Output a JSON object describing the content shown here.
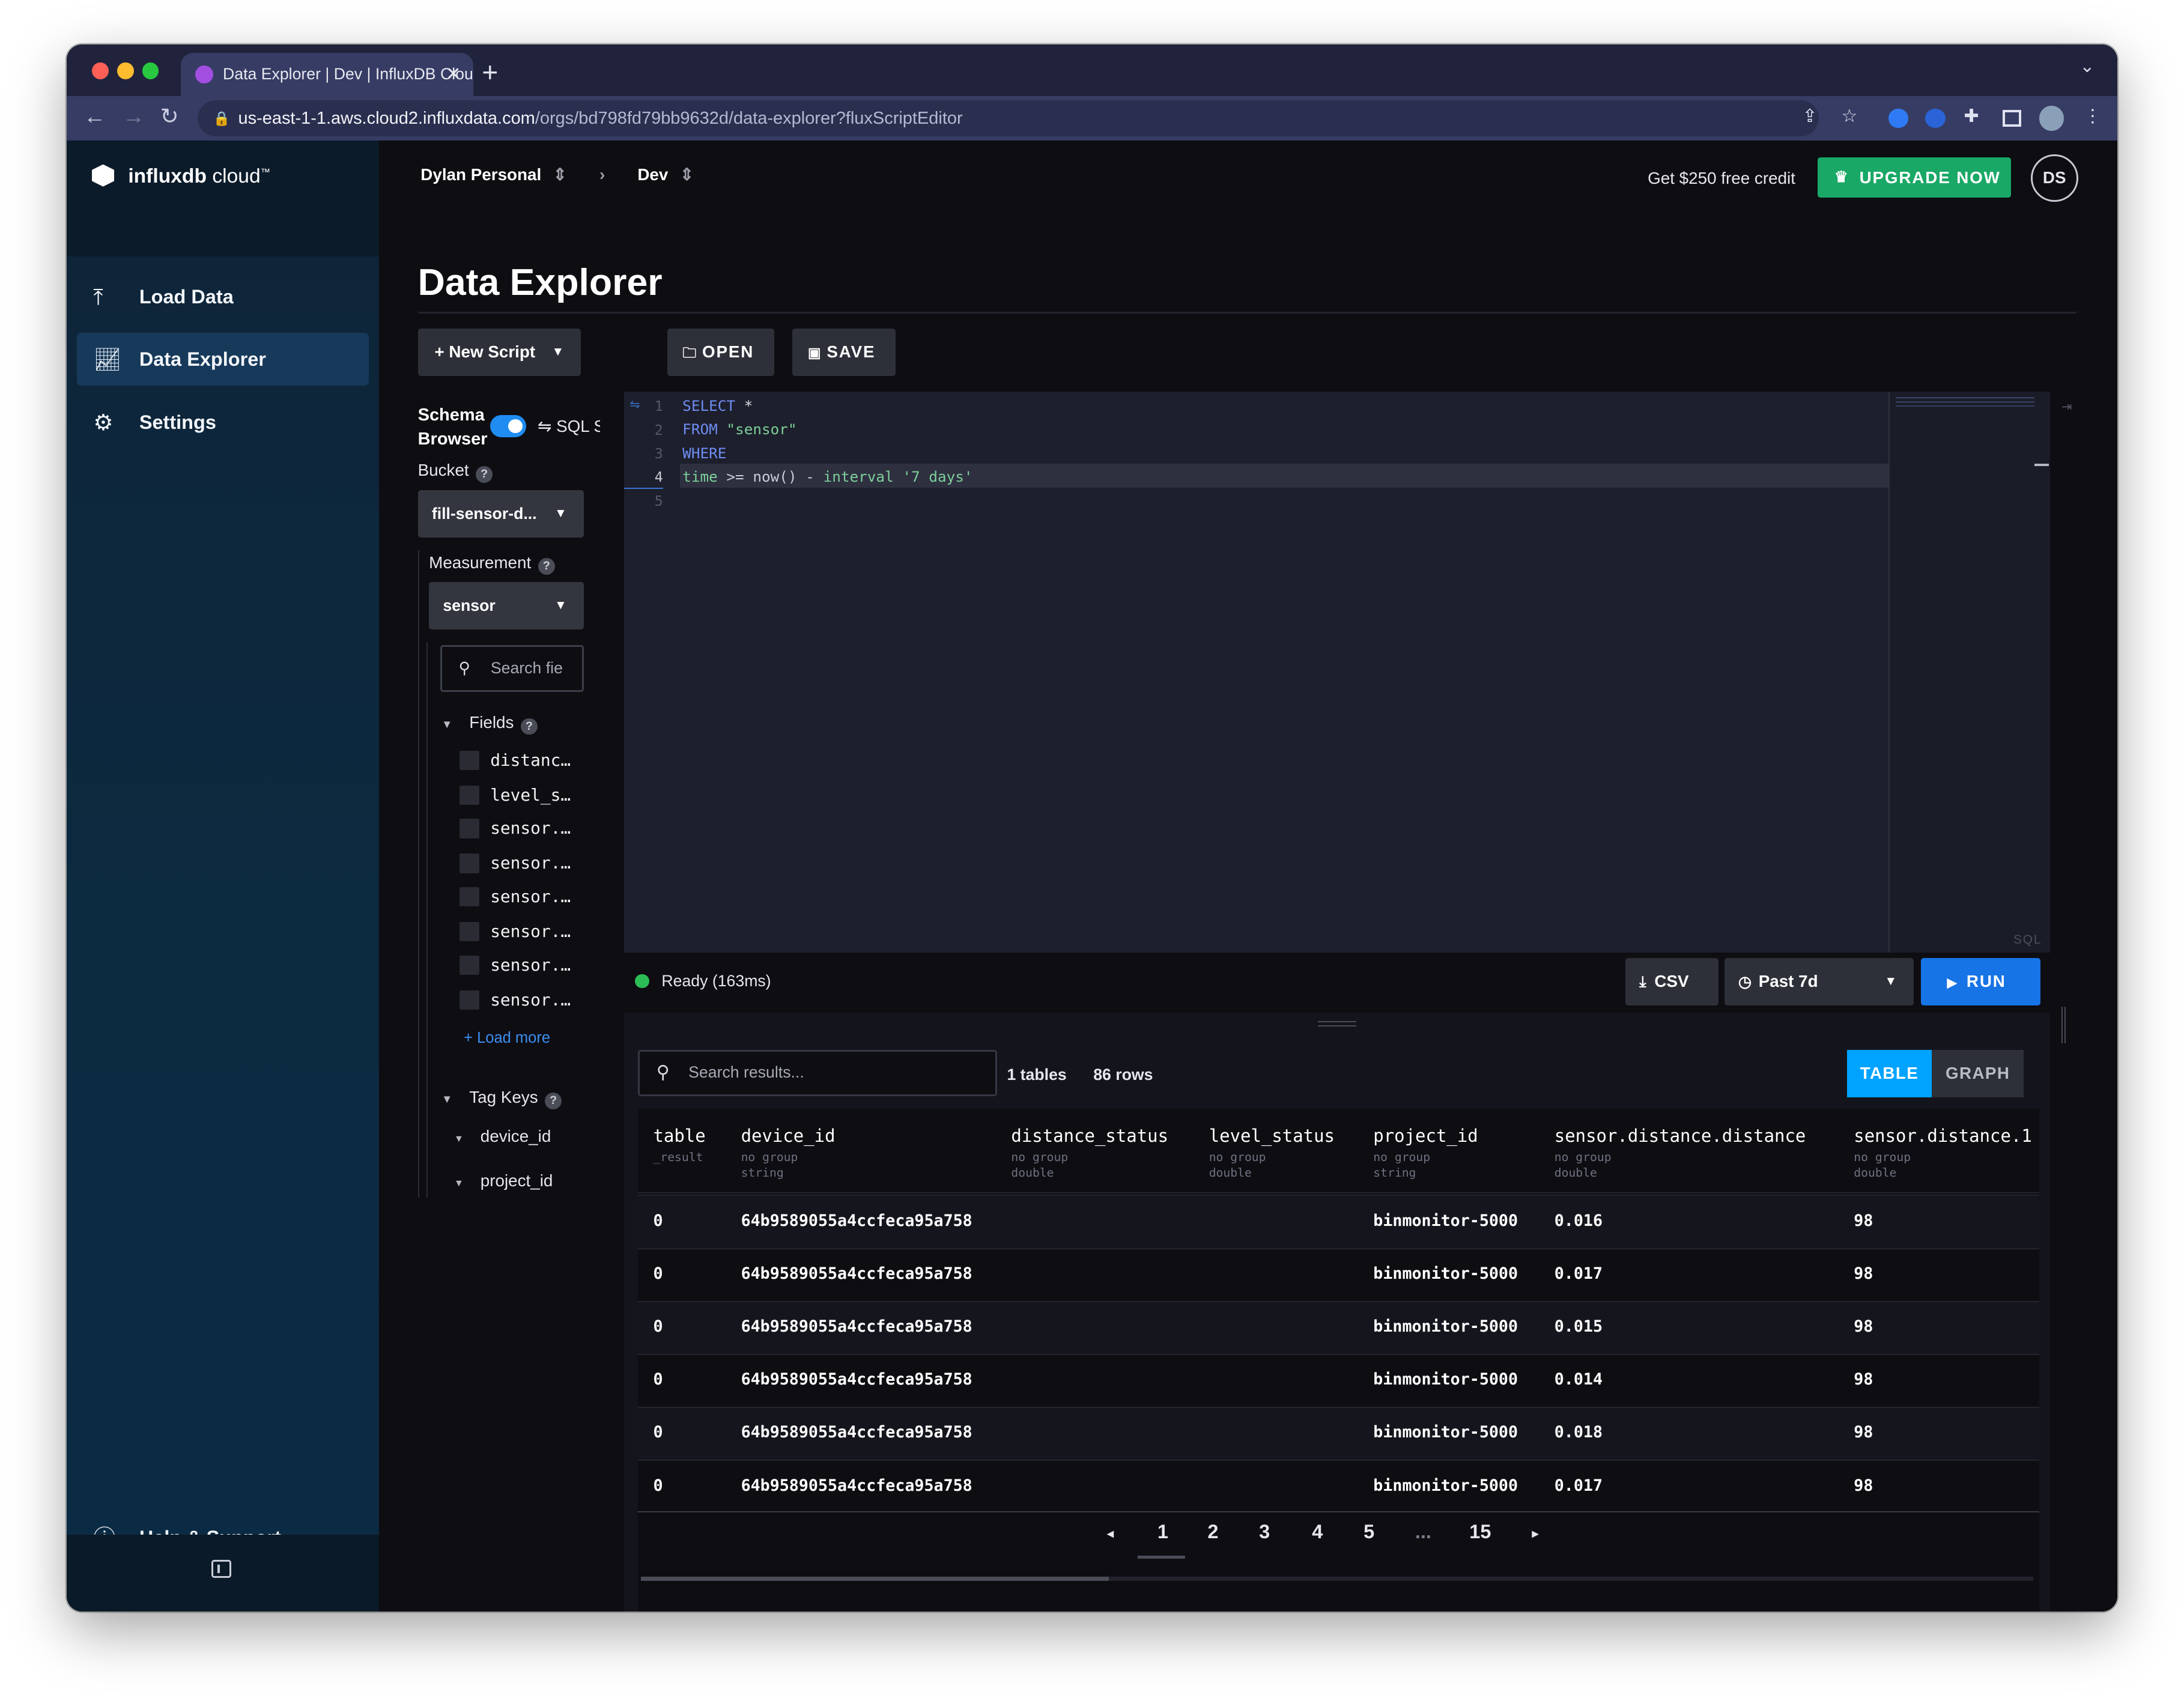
{
  "browser": {
    "tab_title": "Data Explorer | Dev | InfluxDB Cloud",
    "tab_close": "✕",
    "new_tab": "+",
    "url_host": "us-east-1-1.aws.cloud2.influxdata.com",
    "url_path": "/orgs/bd798fd79bb9632d/data-explorer?fluxScriptEditor"
  },
  "sidebar": {
    "logo_bold": "influxdb",
    "logo_light": " cloud",
    "logo_tm": "™",
    "items": [
      {
        "label": "Load Data",
        "icon": "upload-icon"
      },
      {
        "label": "Data Explorer",
        "icon": "chart-line-icon"
      },
      {
        "label": "Settings",
        "icon": "gear-icon"
      }
    ],
    "help": "Help & Support"
  },
  "header": {
    "org": "Dylan Personal",
    "bucket_env": "Dev",
    "credit": "Get $250 free credit",
    "upgrade": "UPGRADE NOW",
    "avatar": "DS"
  },
  "page_title": "Data Explorer",
  "toolbar": {
    "new_script": "New Script",
    "open": "OPEN",
    "save": "SAVE"
  },
  "schema": {
    "title_line1": "Schema",
    "title_line2": "Browser",
    "toggle_label": "SQL S",
    "bucket_label": "Bucket",
    "bucket_value": "fill-sensor-d...",
    "measurement_label": "Measurement",
    "measurement_value": "sensor",
    "search_placeholder": "Search fie",
    "fields_label": "Fields",
    "fields": [
      "distanc…",
      "level_s…",
      "sensor.…",
      "sensor.…",
      "sensor.…",
      "sensor.…",
      "sensor.…",
      "sensor.…"
    ],
    "load_more": "+ Load more",
    "tag_keys_label": "Tag Keys",
    "tag_keys": [
      "device_id",
      "project_id"
    ]
  },
  "editor": {
    "line_numbers": [
      "1",
      "2",
      "3",
      "4",
      "5"
    ],
    "lang": "SQL",
    "code": {
      "l1_kw": "SELECT",
      "l1_rest": " *",
      "l2_kw": "FROM",
      "l2_str": " \"sensor\"",
      "l3_kw": "WHERE",
      "l4_a": "time",
      "l4_b": " >= ",
      "l4_c": "now()",
      "l4_d": " - ",
      "l4_e": "interval",
      "l4_f": " '7 days'"
    }
  },
  "status": {
    "ready": "Ready (163ms)",
    "csv": "CSV",
    "time_range": "Past 7d",
    "run": "RUN"
  },
  "results": {
    "search_placeholder": "Search results...",
    "tables": "1 tables",
    "rows": "86 rows",
    "view_table": "TABLE",
    "view_graph": "GRAPH",
    "columns": [
      {
        "name": "table",
        "sub1": "_result",
        "sub2": ""
      },
      {
        "name": "device_id",
        "sub1": "no group",
        "sub2": "string"
      },
      {
        "name": "distance_status",
        "sub1": "no group",
        "sub2": "double"
      },
      {
        "name": "level_status",
        "sub1": "no group",
        "sub2": "double"
      },
      {
        "name": "project_id",
        "sub1": "no group",
        "sub2": "string"
      },
      {
        "name": "sensor.distance.distance",
        "sub1": "no group",
        "sub2": "double"
      },
      {
        "name": "sensor.distance.1",
        "sub1": "no group",
        "sub2": "double"
      }
    ],
    "rows_data": [
      {
        "table": "0",
        "device_id": "64b9589055a4ccfeca95a758",
        "project_id": "binmonitor-5000",
        "distance": "0.016",
        "last": "98"
      },
      {
        "table": "0",
        "device_id": "64b9589055a4ccfeca95a758",
        "project_id": "binmonitor-5000",
        "distance": "0.017",
        "last": "98"
      },
      {
        "table": "0",
        "device_id": "64b9589055a4ccfeca95a758",
        "project_id": "binmonitor-5000",
        "distance": "0.015",
        "last": "98"
      },
      {
        "table": "0",
        "device_id": "64b9589055a4ccfeca95a758",
        "project_id": "binmonitor-5000",
        "distance": "0.014",
        "last": "98"
      },
      {
        "table": "0",
        "device_id": "64b9589055a4ccfeca95a758",
        "project_id": "binmonitor-5000",
        "distance": "0.018",
        "last": "98"
      },
      {
        "table": "0",
        "device_id": "64b9589055a4ccfeca95a758",
        "project_id": "binmonitor-5000",
        "distance": "0.017",
        "last": "98"
      }
    ],
    "pagination": [
      "1",
      "2",
      "3",
      "4",
      "5",
      "...",
      "15"
    ],
    "current_page": "1"
  },
  "colors": {
    "upgrade": "#19a866",
    "run": "#1774e6",
    "table_tab": "#00a3ff",
    "status_ready": "#2cbd55",
    "sidebar_active": "#17395a"
  }
}
